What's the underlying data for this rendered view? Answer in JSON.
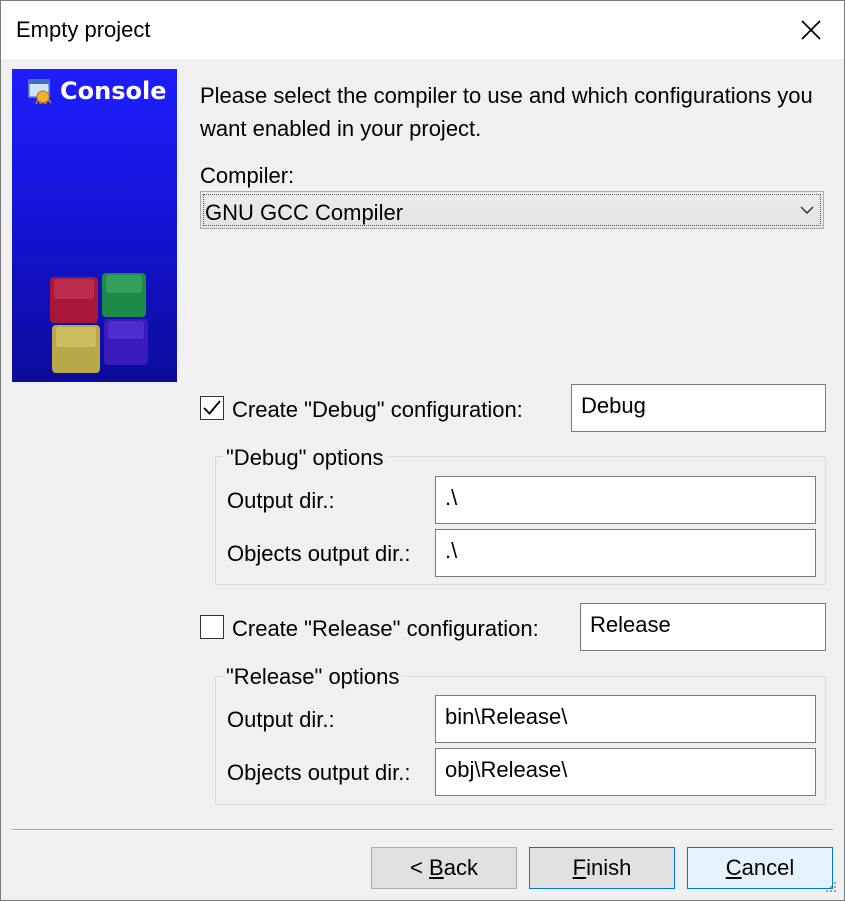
{
  "window": {
    "title": "Empty project",
    "close_icon": "close-icon"
  },
  "banner": {
    "label": "Console",
    "icon": "console-app-icon",
    "logo": "codeblocks-cube-logo"
  },
  "intro": "Please select the compiler to use and which configurations you want enabled in your project.",
  "compiler": {
    "label": "Compiler:",
    "value": "GNU GCC Compiler"
  },
  "debug": {
    "checkbox_label": "Create \"Debug\" configuration:",
    "checked": true,
    "name": "Debug",
    "group_title": "\"Debug\" options",
    "output_label": "Output dir.:",
    "output_value": ".\\",
    "objects_label": "Objects output dir.:",
    "objects_value": ".\\"
  },
  "release": {
    "checkbox_label": "Create \"Release\" configuration:",
    "checked": false,
    "name": "Release",
    "group_title": "\"Release\" options",
    "output_label": "Output dir.:",
    "output_value": "bin\\Release\\",
    "objects_label": "Objects output dir.:",
    "objects_value": "obj\\Release\\"
  },
  "buttons": {
    "back_prefix": "< ",
    "back_mnemonic": "B",
    "back_rest": "ack",
    "finish_mnemonic": "F",
    "finish_rest": "inish",
    "cancel_mnemonic": "C",
    "cancel_rest": "ancel"
  },
  "colors": {
    "accent": "#0078d7",
    "banner_blue": "#1414d8",
    "dialog_bg": "#f0f0f0"
  }
}
